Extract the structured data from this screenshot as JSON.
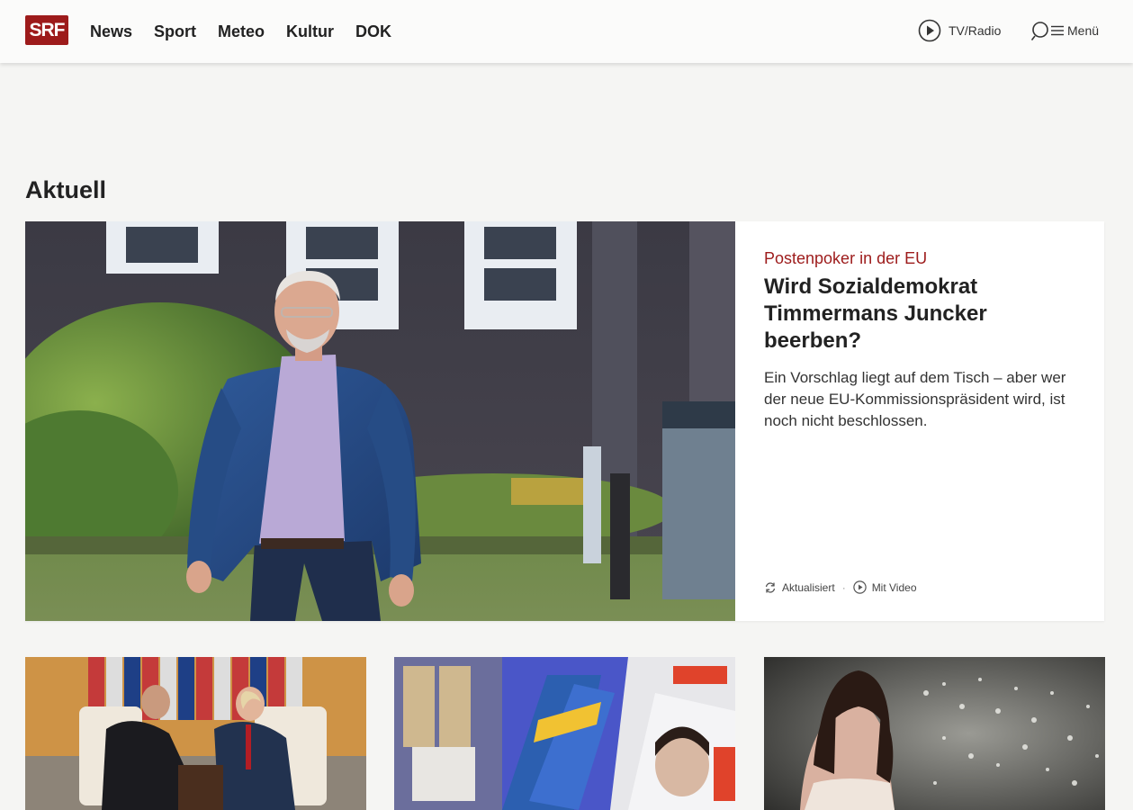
{
  "header": {
    "logo_text": "SRF",
    "nav": [
      "News",
      "Sport",
      "Meteo",
      "Kultur",
      "DOK"
    ],
    "tv_radio_label": "TV/Radio",
    "menu_label": "Menü"
  },
  "section": {
    "title": "Aktuell"
  },
  "hero": {
    "kicker": "Postenpoker in der EU",
    "headline": "Wird Sozialdemokrat Timmermans Juncker beerben?",
    "lead": "Ein Vorschlag liegt auf dem Tisch – aber wer der neue EU-Kommissionspräsident wird, ist noch nicht beschlossen.",
    "meta_updated": "Aktualisiert",
    "meta_video": "Mit Video"
  },
  "colors": {
    "brand_red": "#9d1b1b",
    "background": "#f5f5f3"
  }
}
